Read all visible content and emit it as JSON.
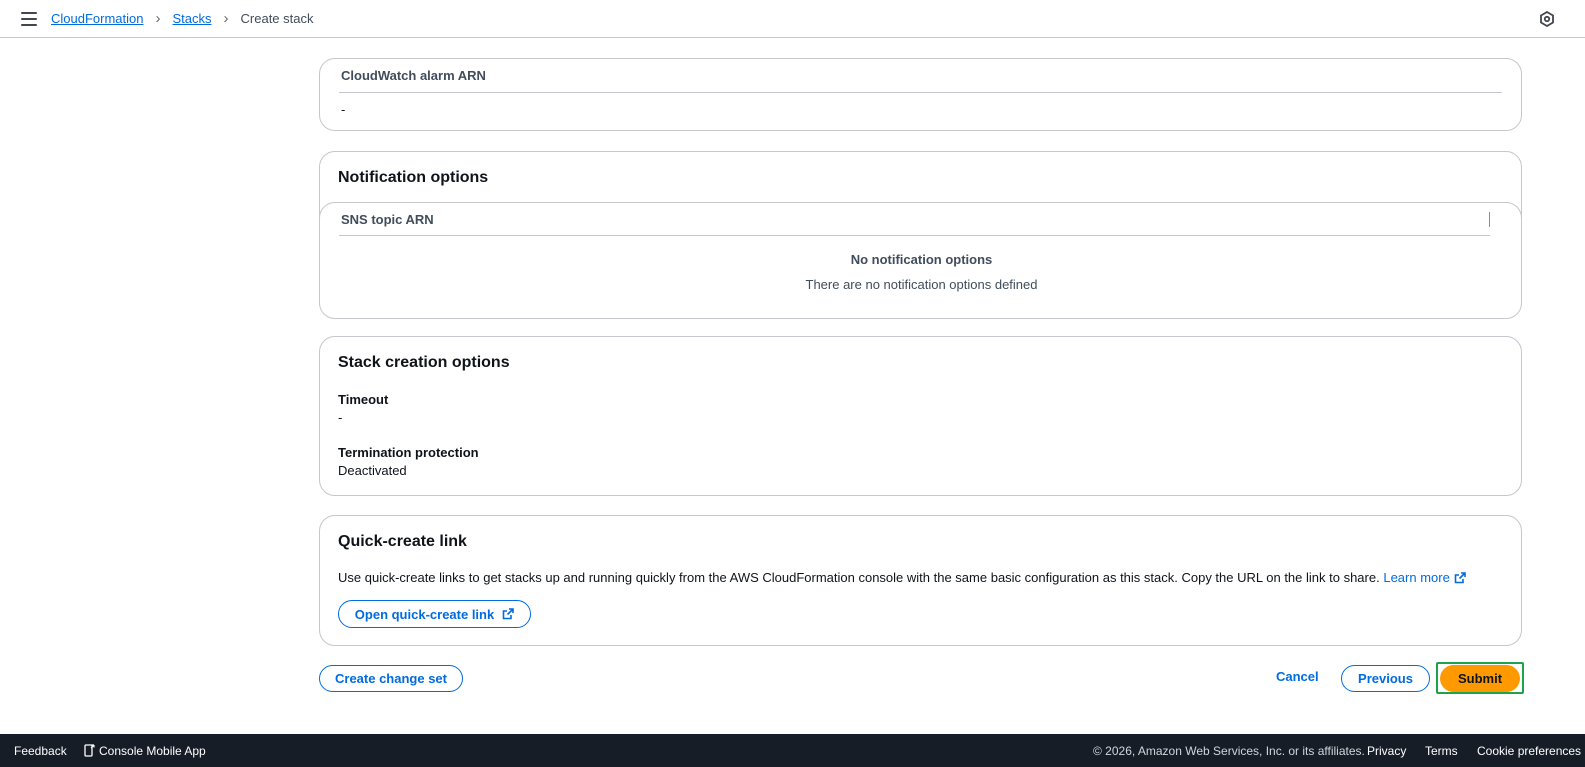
{
  "breadcrumb": {
    "items": [
      "CloudFormation",
      "Stacks"
    ],
    "current": "Create stack"
  },
  "cloudwatch": {
    "header": "CloudWatch alarm ARN",
    "value": "-"
  },
  "notification": {
    "title": "Notification options",
    "header": "SNS topic ARN",
    "empty_title": "No notification options",
    "empty_text": "There are no notification options defined"
  },
  "stack_creation": {
    "title": "Stack creation options",
    "timeout_label": "Timeout",
    "timeout_value": "-",
    "termination_label": "Termination protection",
    "termination_value": "Deactivated"
  },
  "quick_create": {
    "title": "Quick-create link",
    "description": "Use quick-create links to get stacks up and running quickly from the AWS CloudFormation console with the same basic configuration as this stack. Copy the URL on the link to share.",
    "learn_more": "Learn more",
    "open_button": "Open quick-create link"
  },
  "actions": {
    "create_change_set": "Create change set",
    "cancel": "Cancel",
    "previous": "Previous",
    "submit": "Submit"
  },
  "footer": {
    "feedback": "Feedback",
    "mobile_app": "Console Mobile App",
    "copyright": "© 2026, Amazon Web Services, Inc. or its affiliates.",
    "privacy": "Privacy",
    "terms": "Terms",
    "cookie": "Cookie preferences"
  },
  "colors": {
    "link": "#006ce0",
    "primary": "#ff9900",
    "footer_bg": "#161d26",
    "focus": "#1fa34a"
  }
}
